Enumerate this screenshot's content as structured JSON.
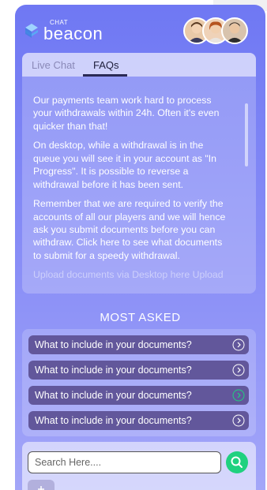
{
  "brand": {
    "logo_small": "CHAT",
    "logo_big": "beacon",
    "colors": {
      "primary": "#6f78f3",
      "accent_green": "#1fd17f",
      "question_bg": "#62579b"
    }
  },
  "agents": [
    {
      "name": "agent-avatar-1"
    },
    {
      "name": "agent-avatar-2"
    },
    {
      "name": "agent-avatar-3"
    }
  ],
  "tabs": [
    {
      "label": "Live Chat",
      "active": false
    },
    {
      "label": "FAQs",
      "active": true
    }
  ],
  "faq": {
    "paragraphs": [
      "Our payments team work hard to process your withdrawals within 24h. Often it's even quicker than that!",
      "On desktop, while a withdrawal is in the queue you will see it in your account as \"In Progress\". It is possible to reverse a withdrawal before it has been sent.",
      "Remember that we are required to verify the accounts of all our players and we will hence ask you submit documents before you can withdraw. Click here to see what documents to submit for a speedy withdrawal.",
      "Upload documents via Desktop here Upload"
    ]
  },
  "most_asked": {
    "title": "MOST ASKED",
    "questions": [
      {
        "label": "What to include in your documents?",
        "icon": "chevron-right-icon"
      },
      {
        "label": "What to include in your documents?",
        "icon": "chevron-right-icon"
      },
      {
        "label": "What to include in your documents?",
        "icon": "chevron-right-icon"
      },
      {
        "label": "What to include in your documents?",
        "icon": "chevron-right-icon"
      }
    ]
  },
  "search": {
    "placeholder": "Search Here....",
    "icon": "search-icon"
  },
  "attach": {
    "icon": "plus-icon"
  }
}
